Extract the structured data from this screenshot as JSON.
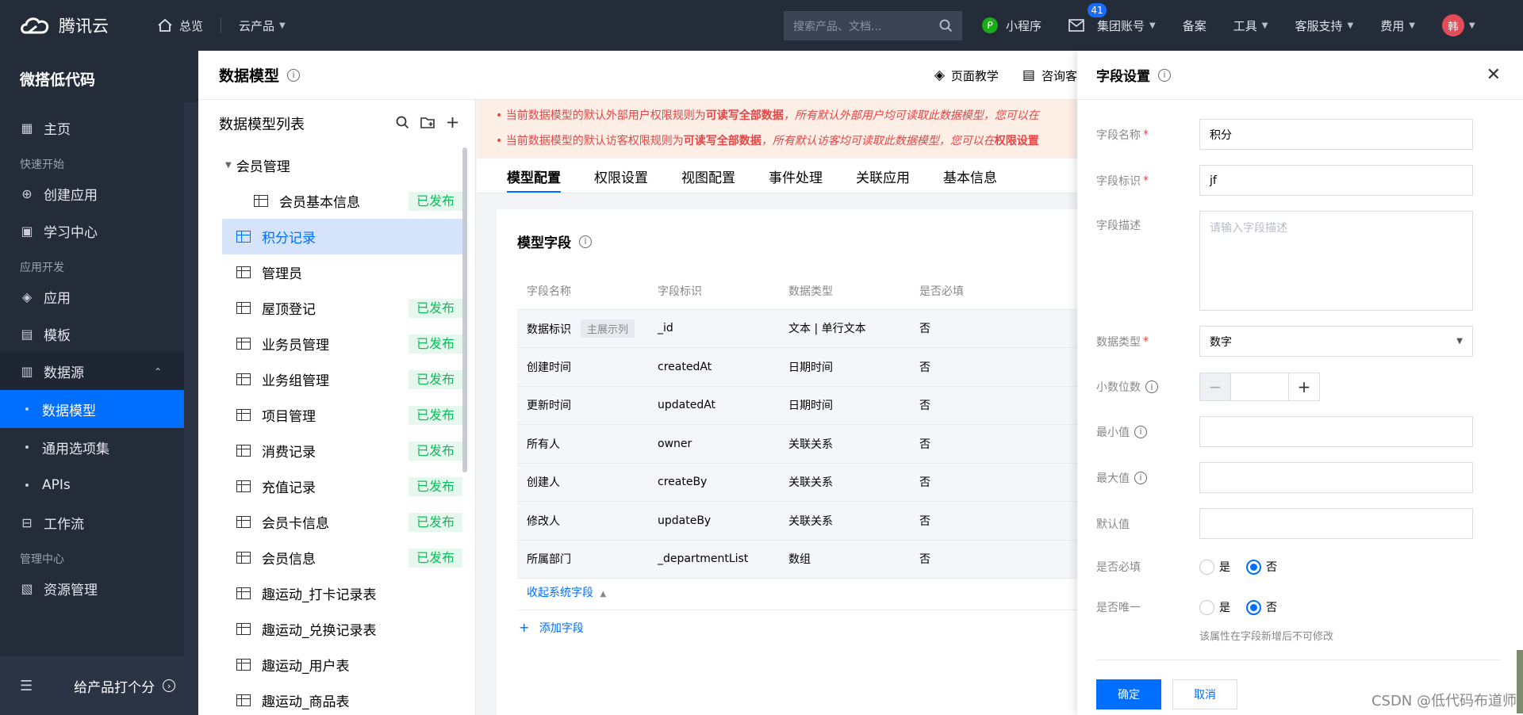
{
  "topbar": {
    "brand": "腾讯云",
    "home": "总览",
    "products": "云产品",
    "search_placeholder": "搜索产品、文档...",
    "miniprogram": "小程序",
    "mail_count": "41",
    "group_account": "集团账号",
    "filing": "备案",
    "tools": "工具",
    "support": "客服支持",
    "billing": "费用",
    "avatar_text": "韩"
  },
  "nav": {
    "title": "微搭低代码",
    "home": "主页",
    "group_quickstart": "快速开始",
    "create_app": "创建应用",
    "learning": "学习中心",
    "group_dev": "应用开发",
    "apps": "应用",
    "templates": "模板",
    "datasource": "数据源",
    "data_model": "数据模型",
    "option_sets": "通用选项集",
    "apis": "APIs",
    "workflow": "工作流",
    "group_admin": "管理中心",
    "resources": "资源管理",
    "rate": "给产品打个分"
  },
  "header": {
    "title": "数据模型",
    "page_tutorial": "页面教学",
    "consult": "咨询客"
  },
  "model_list": {
    "title": "数据模型列表",
    "published_label": "已发布",
    "group": "会员管理",
    "items": [
      {
        "label": "会员基本信息",
        "published": true,
        "level": "child"
      },
      {
        "label": "积分记录",
        "published": false,
        "level": "top",
        "selected": true
      },
      {
        "label": "管理员",
        "published": false,
        "level": "top"
      },
      {
        "label": "屋顶登记",
        "published": true,
        "level": "top"
      },
      {
        "label": "业务员管理",
        "published": true,
        "level": "top"
      },
      {
        "label": "业务组管理",
        "published": true,
        "level": "top"
      },
      {
        "label": "项目管理",
        "published": true,
        "level": "top"
      },
      {
        "label": "消费记录",
        "published": true,
        "level": "top"
      },
      {
        "label": "充值记录",
        "published": true,
        "level": "top"
      },
      {
        "label": "会员卡信息",
        "published": true,
        "level": "top"
      },
      {
        "label": "会员信息",
        "published": true,
        "level": "top"
      },
      {
        "label": "趣运动_打卡记录表",
        "published": false,
        "level": "top"
      },
      {
        "label": "趣运动_兑换记录表",
        "published": false,
        "level": "top"
      },
      {
        "label": "趣运动_用户表",
        "published": false,
        "level": "top"
      },
      {
        "label": "趣运动_商品表",
        "published": false,
        "level": "top"
      }
    ]
  },
  "notice": {
    "line1_a": "当前数据模型的默认外部用户权限规则为",
    "line1_b": "可读写全部数据",
    "line1_c": "，所有默认外部用户均可读取此数据模型，您可以在",
    "line2_a": "当前数据模型的默认访客权限规则为",
    "line2_b": "可读写全部数据",
    "line2_c": "，所有默认访客均可读取此数据模型，您可以在",
    "line2_d": "权限设置"
  },
  "tabs": [
    "模型配置",
    "权限设置",
    "视图配置",
    "事件处理",
    "关联应用",
    "基本信息"
  ],
  "card": {
    "title": "模型字段",
    "columns": [
      "字段名称",
      "字段标识",
      "数据类型",
      "是否必填"
    ],
    "rows": [
      [
        "数据标识",
        "_id",
        "文本 | 单行文本",
        "否"
      ],
      [
        "创建时间",
        "createdAt",
        "日期时间",
        "否"
      ],
      [
        "更新时间",
        "updatedAt",
        "日期时间",
        "否"
      ],
      [
        "所有人",
        "owner",
        "关联关系",
        "否"
      ],
      [
        "创建人",
        "createBy",
        "关联关系",
        "否"
      ],
      [
        "修改人",
        "updateBy",
        "关联关系",
        "否"
      ],
      [
        "所属部门",
        "_departmentList",
        "数组",
        "否"
      ]
    ],
    "primary_tag": "主展示列",
    "collapse": "收起系统字段",
    "add_field": "添加字段"
  },
  "drawer": {
    "title": "字段设置",
    "name_label": "字段名称",
    "name_value": "积分",
    "id_label": "字段标识",
    "id_value": "jf",
    "desc_label": "字段描述",
    "desc_placeholder": "请输入字段描述",
    "type_label": "数据类型",
    "type_value": "数字",
    "decimals_label": "小数位数",
    "min_label": "最小值",
    "max_label": "最大值",
    "default_label": "默认值",
    "required_label": "是否必填",
    "unique_label": "是否唯一",
    "yes": "是",
    "no": "否",
    "unique_hint": "该属性在字段新增后不可修改",
    "confirm": "确定",
    "cancel": "取消"
  },
  "watermark": "CSDN @低代码布道师",
  "colors": {
    "primary": "#006eff",
    "published": "#0abf5b",
    "topbar": "#242c3a",
    "warning": "#e54545"
  }
}
